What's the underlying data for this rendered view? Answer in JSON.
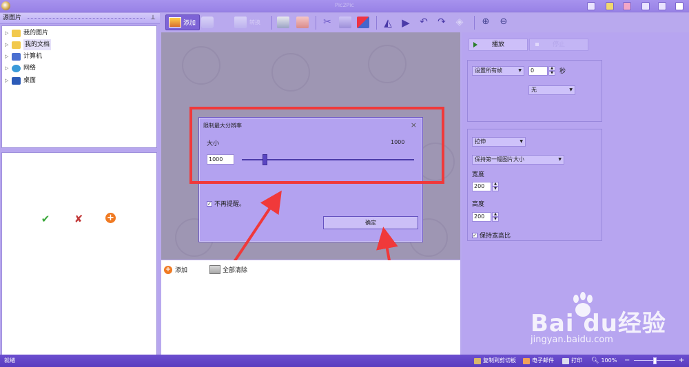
{
  "window": {
    "title": "Pic2Pic"
  },
  "source_panel": {
    "title": "源图片",
    "tree": [
      {
        "label": "我的图片",
        "icon": "pictures-folder-icon",
        "color": "#f2c94c"
      },
      {
        "label": "我的文档",
        "icon": "documents-folder-icon",
        "color": "#f2c94c",
        "selected": true
      },
      {
        "label": "计算机",
        "icon": "computer-icon",
        "color": "#4a6fd1"
      },
      {
        "label": "网络",
        "icon": "network-icon",
        "color": "#3a9ad9"
      },
      {
        "label": "桌面",
        "icon": "desktop-icon",
        "color": "#2c5bb8"
      }
    ]
  },
  "toolbar": {
    "add_label": "添加",
    "dim_label": "转换"
  },
  "dialog": {
    "title": "限制最大分辨率",
    "size_label": "大小",
    "size_value": "1000",
    "input_value": "1000",
    "slider_fraction": 0.13,
    "no_remind_label": "不再提醒。",
    "no_remind_checked": true,
    "ok_label": "确定"
  },
  "list_actions": {
    "add_label": "添加",
    "clear_all_label": "全部清除"
  },
  "right_panel": {
    "play_label": "播放",
    "stop_label": "停止",
    "frame_select": "设置所有帧",
    "seconds_value": "0",
    "seconds_unit": "秒",
    "effect_select": "无",
    "stretch_select": "拉伸",
    "size_mode_select": "保持第一幅图片大小",
    "width_label": "宽度",
    "width_value": "200",
    "height_label": "高度",
    "height_value": "200",
    "keep_ratio_label": "保持宽高比",
    "keep_ratio_checked": true
  },
  "statusbar": {
    "status": "就绪",
    "copy_label": "复制到剪切板",
    "email_label": "电子邮件",
    "print_label": "打印",
    "zoom_label": "100%"
  },
  "watermark": {
    "brand": "Bai du经验",
    "url": "jingyan.baidu.com"
  },
  "colors": {
    "accent": "#7d63d6",
    "highlight": "#f0393a",
    "statusbar": "#5a3dbf"
  }
}
